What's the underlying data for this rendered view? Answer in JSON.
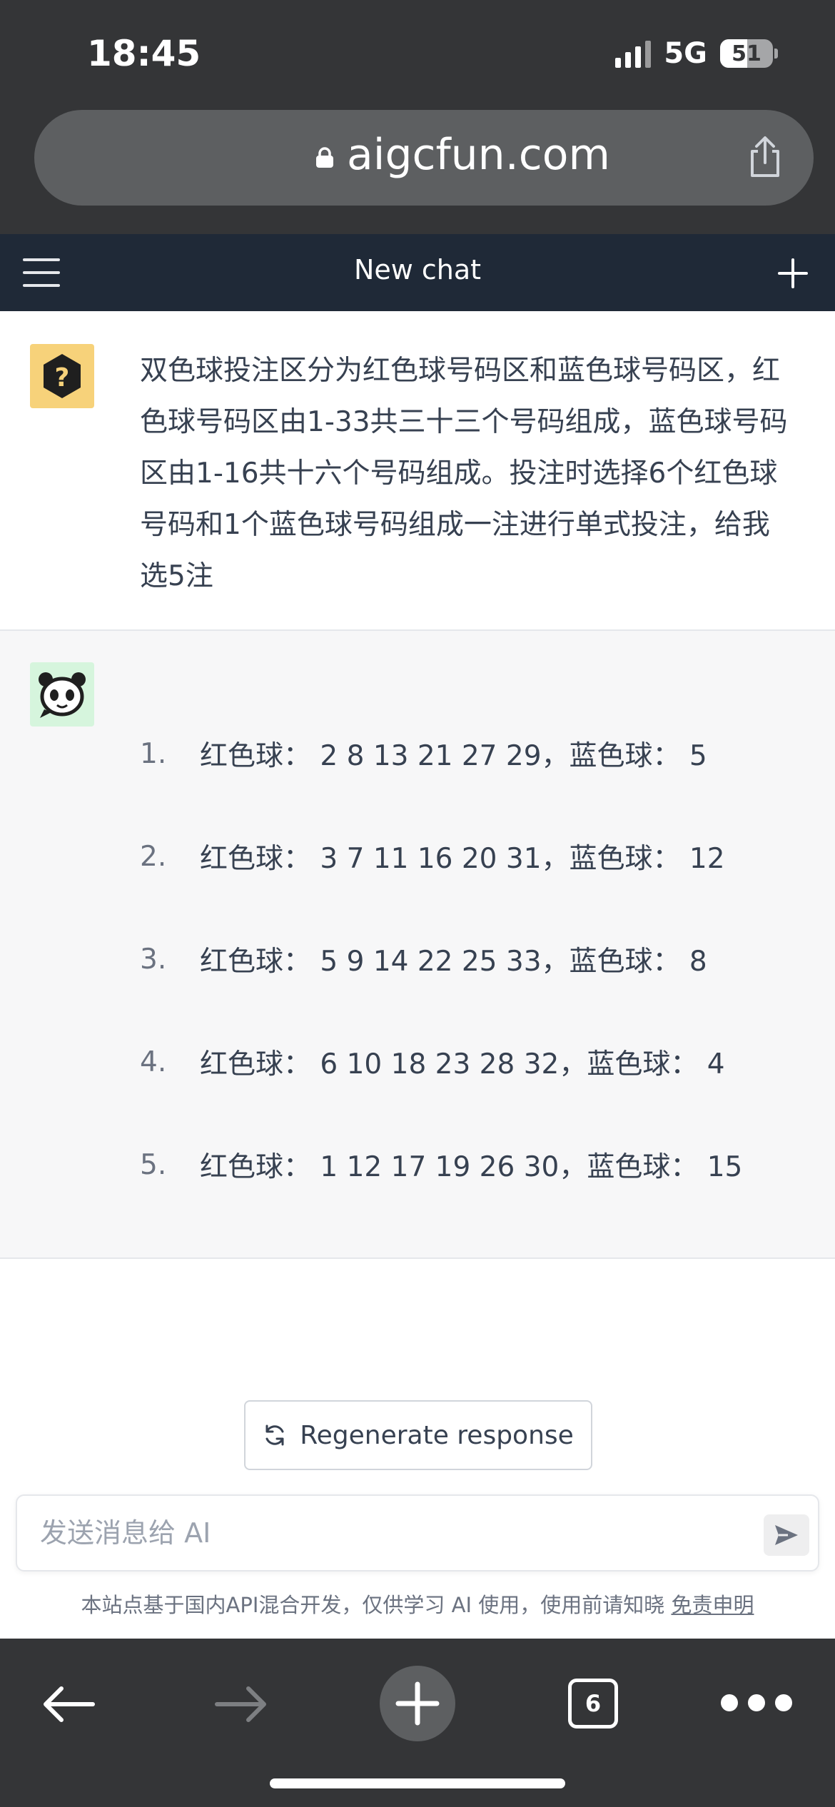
{
  "status_bar": {
    "time": "18:45",
    "network": "5G",
    "battery": "51",
    "battery_level": 0.51
  },
  "browser": {
    "url": "aigcfun.com",
    "tab_count": "6"
  },
  "header": {
    "title": "New chat"
  },
  "user_message": {
    "text": "双色球投注区分为红色球号码区和蓝色球号码区，红色球号码区由1-33共三十三个号码组成，蓝色球号码区由1-16共十六个号码组成。投注时选择6个红色球号码和1个蓝色球号码组成一注进行单式投注，给我选5注"
  },
  "assistant_message": {
    "items": [
      {
        "num": "1.",
        "text": "红色球： 2 8 13 21 27 29，蓝色球： 5"
      },
      {
        "num": "2.",
        "text": "红色球： 3 7 11 16 20 31，蓝色球： 12"
      },
      {
        "num": "3.",
        "text": "红色球： 5 9 14 22 25 33，蓝色球： 8"
      },
      {
        "num": "4.",
        "text": "红色球： 6 10 18 23 28 32，蓝色球： 4"
      },
      {
        "num": "5.",
        "text": "红色球： 1 12 17 19 26 30，蓝色球： 15"
      }
    ]
  },
  "regenerate": {
    "label": "Regenerate response"
  },
  "composer": {
    "placeholder": "发送消息给 AI",
    "value": ""
  },
  "footer": {
    "note": "本站点基于国内API混合开发，仅供学习 AI 使用，使用前请知晓",
    "disclaimer_link": "免责申明"
  },
  "icons": {
    "lock": "lock-icon",
    "share": "share-icon",
    "menu": "hamburger-menu-icon",
    "new_chat": "plus-icon",
    "user_avatar": "question-mark-icon",
    "bot_avatar": "panda-icon",
    "regenerate": "refresh-icon",
    "send": "paper-plane-icon",
    "back": "arrow-left-icon",
    "forward": "arrow-right-icon",
    "more": "ellipsis-icon"
  },
  "colors": {
    "header_bg": "#1f2937",
    "chrome_bg": "#343537",
    "user_avatar_bg": "#f7d27a",
    "bot_avatar_bg": "#d6f5dd",
    "assistant_bg": "#f7f7f8"
  }
}
